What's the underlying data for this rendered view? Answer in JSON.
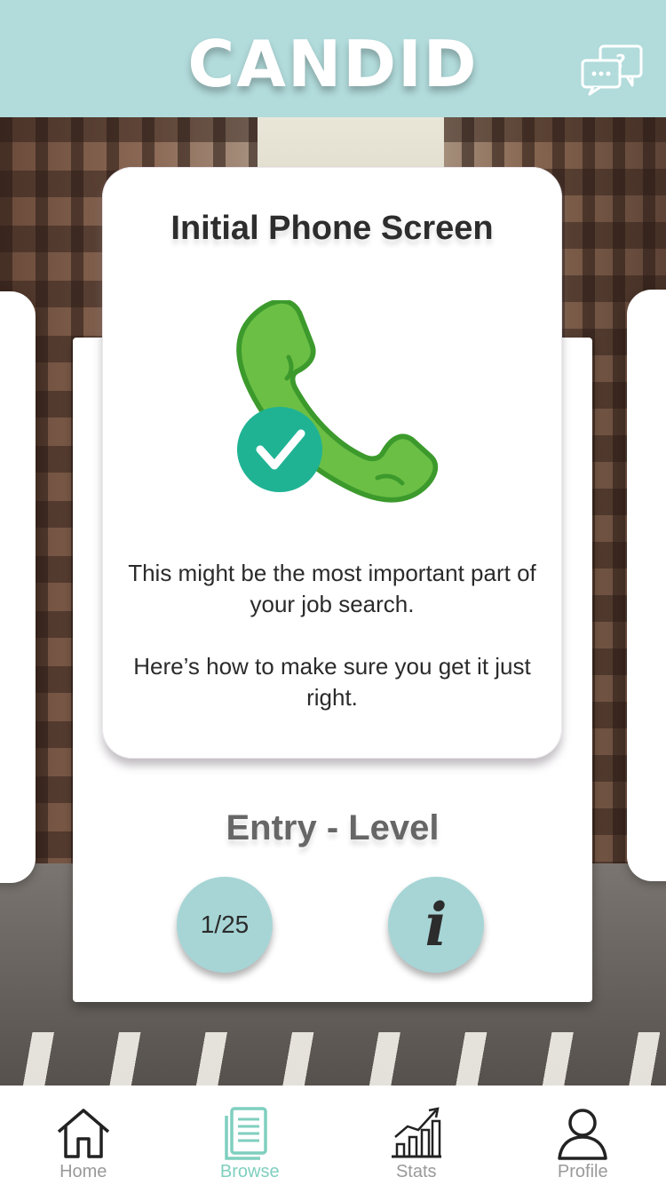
{
  "header": {
    "logo_text": "CANDID",
    "help_icon": "chat-question-icon"
  },
  "card": {
    "title": "Initial Phone Screen",
    "icon": "phone-check-icon",
    "description_1": "This might be the most important part of your job search.",
    "description_2": "Here’s how to make sure you get it just right.",
    "level": "Entry - Level",
    "counter": "1/25",
    "info_glyph": "i"
  },
  "colors": {
    "header_bg": "#b2dbdb",
    "button_bg": "#a7d5d6",
    "phone_green": "#6cbf45",
    "check_teal": "#1fb394",
    "active_tab": "#7fcfbf"
  },
  "tabs": [
    {
      "label": "Home",
      "icon": "home-icon",
      "active": false
    },
    {
      "label": "Browse",
      "icon": "document-icon",
      "active": true
    },
    {
      "label": "Stats",
      "icon": "bar-chart-icon",
      "active": false
    },
    {
      "label": "Profile",
      "icon": "person-icon",
      "active": false
    }
  ]
}
